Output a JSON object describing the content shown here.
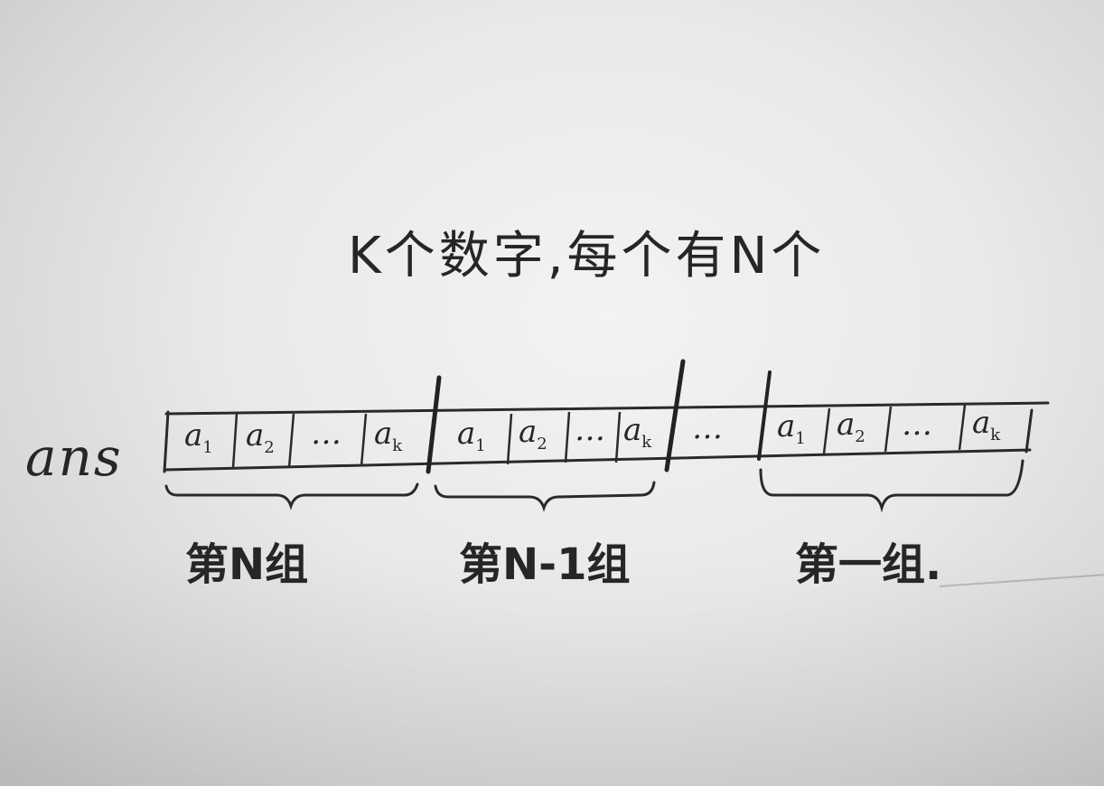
{
  "title": "K个数字,每个有N个",
  "row_label": "ans",
  "groups": [
    {
      "label": "第N组",
      "cells": [
        {
          "base": "a",
          "sub": "1"
        },
        {
          "base": "a",
          "sub": "2"
        },
        {
          "base": "…",
          "sub": ""
        },
        {
          "base": "a",
          "sub": "k"
        }
      ]
    },
    {
      "label": "第N-1组",
      "cells": [
        {
          "base": "a",
          "sub": "1"
        },
        {
          "base": "a",
          "sub": "2"
        },
        {
          "base": "…",
          "sub": ""
        },
        {
          "base": "a",
          "sub": "k"
        }
      ]
    },
    {
      "label": "",
      "cells": [
        {
          "base": "…",
          "sub": ""
        }
      ]
    },
    {
      "label": "第一组.",
      "cells": [
        {
          "base": "a",
          "sub": "1"
        },
        {
          "base": "a",
          "sub": "2"
        },
        {
          "base": "…",
          "sub": ""
        },
        {
          "base": "a",
          "sub": "k"
        }
      ]
    }
  ],
  "ink_color": "#262626",
  "paper_color": "#ececea"
}
